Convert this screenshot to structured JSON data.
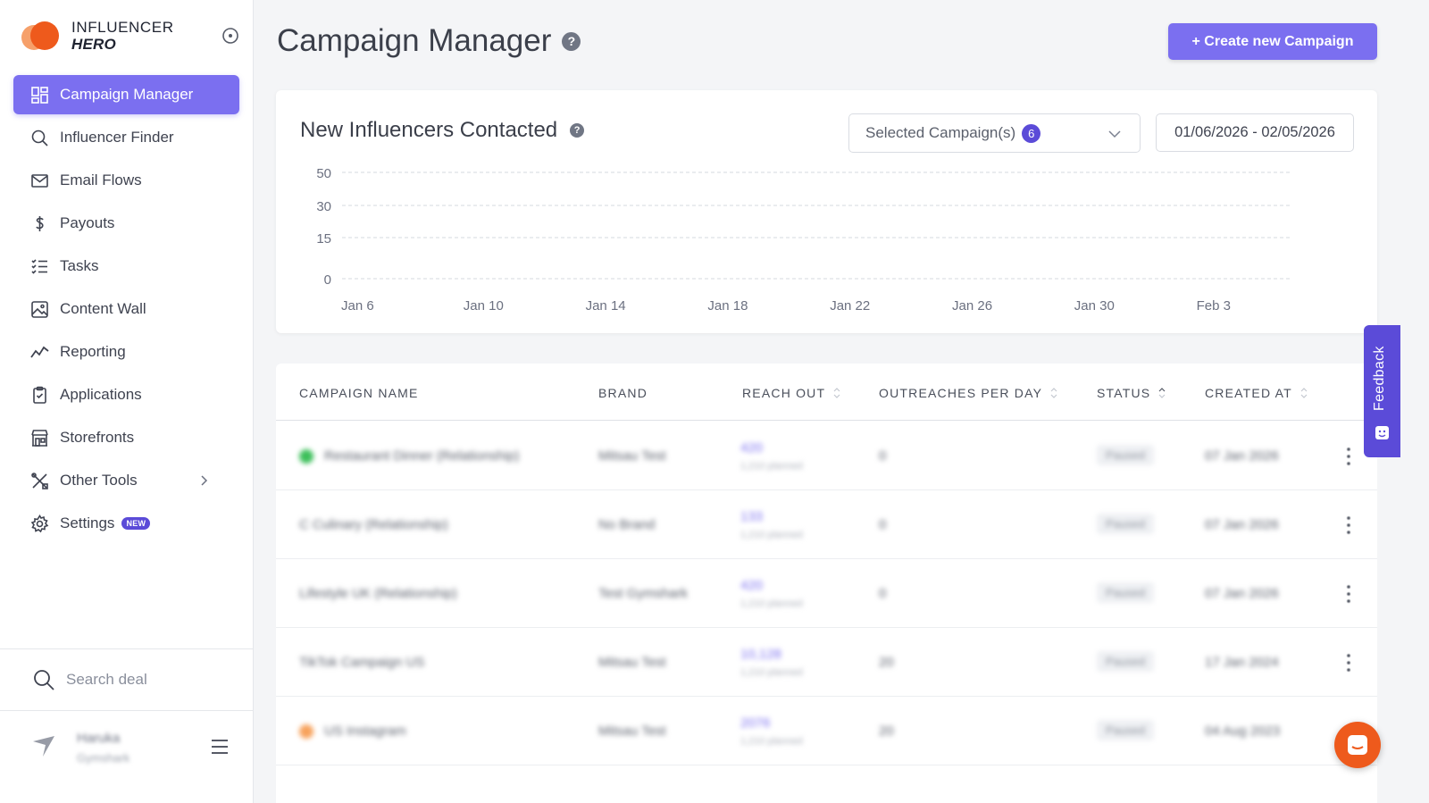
{
  "brand": {
    "line1": "INFLUENCER",
    "line2": "HERO"
  },
  "nav": {
    "items": [
      {
        "label": "Campaign Manager",
        "icon": "grid-icon"
      },
      {
        "label": "Influencer Finder",
        "icon": "search-icon"
      },
      {
        "label": "Email Flows",
        "icon": "mail-icon"
      },
      {
        "label": "Payouts",
        "icon": "dollar-icon"
      },
      {
        "label": "Tasks",
        "icon": "checklist-icon"
      },
      {
        "label": "Content Wall",
        "icon": "image-icon"
      },
      {
        "label": "Reporting",
        "icon": "trend-icon"
      },
      {
        "label": "Applications",
        "icon": "clipboard-icon"
      },
      {
        "label": "Storefronts",
        "icon": "store-icon"
      },
      {
        "label": "Other Tools",
        "icon": "tools-icon"
      },
      {
        "label": "Settings",
        "icon": "gear-icon",
        "badge": "NEW"
      }
    ]
  },
  "sidebar_search": {
    "placeholder": "Search deal"
  },
  "user": {
    "name": "Haruka",
    "company": "Gymshark"
  },
  "header": {
    "title": "Campaign Manager",
    "help": "?",
    "create_label": "+ Create new Campaign"
  },
  "chart_card": {
    "title": "New Influencers Contacted",
    "help": "?",
    "select_label": "Selected Campaign(s)",
    "select_count": "6",
    "date_range": "01/06/2026 - 02/05/2026"
  },
  "chart_data": {
    "type": "line",
    "title": "New Influencers Contacted",
    "y_ticks": [
      0,
      15,
      30,
      50
    ],
    "x_ticks": [
      "Jan 6",
      "Jan 10",
      "Jan 14",
      "Jan 18",
      "Jan 22",
      "Jan 26",
      "Jan 30",
      "Feb 3"
    ],
    "ylim": [
      0,
      50
    ],
    "grid": true,
    "series": []
  },
  "table": {
    "columns": [
      "CAMPAIGN NAME",
      "BRAND",
      "REACH OUT",
      "OUTREACHES PER DAY",
      "STATUS",
      "CREATED AT"
    ],
    "rows": [
      {
        "dot": "#3cbf5a",
        "name": "Restaurant Dinner (Relationship)",
        "brand": "Mitsau Test",
        "reach": "420",
        "reach_sub": "1,210 planned",
        "per_day": "0",
        "status": "Paused",
        "created": "07 Jan 2026"
      },
      {
        "dot": "",
        "name": "C Culinary (Relationship)",
        "brand": "No Brand",
        "reach": "133",
        "reach_sub": "1,210 planned",
        "per_day": "0",
        "status": "Paused",
        "created": "07 Jan 2026"
      },
      {
        "dot": "",
        "name": "Lifestyle UK (Relationship)",
        "brand": "Test Gymshark",
        "reach": "420",
        "reach_sub": "1,210 planned",
        "per_day": "0",
        "status": "Paused",
        "created": "07 Jan 2026"
      },
      {
        "dot": "",
        "name": "TikTok Campaign US",
        "brand": "Mitsau Test",
        "reach": "10,128",
        "reach_sub": "1,210 planned",
        "per_day": "20",
        "status": "Paused",
        "created": "17 Jan 2024"
      },
      {
        "dot": "#f7a25c",
        "name": "US Instagram",
        "brand": "Mitsau Test",
        "reach": "2076",
        "reach_sub": "1,210 planned",
        "per_day": "20",
        "status": "Paused",
        "created": "04 Aug 2023"
      }
    ]
  },
  "feedback_label": "Feedback",
  "colors": {
    "accent": "#7b6ff0",
    "accent_dark": "#5b4bd8",
    "brand_orange": "#ee5a1c"
  }
}
